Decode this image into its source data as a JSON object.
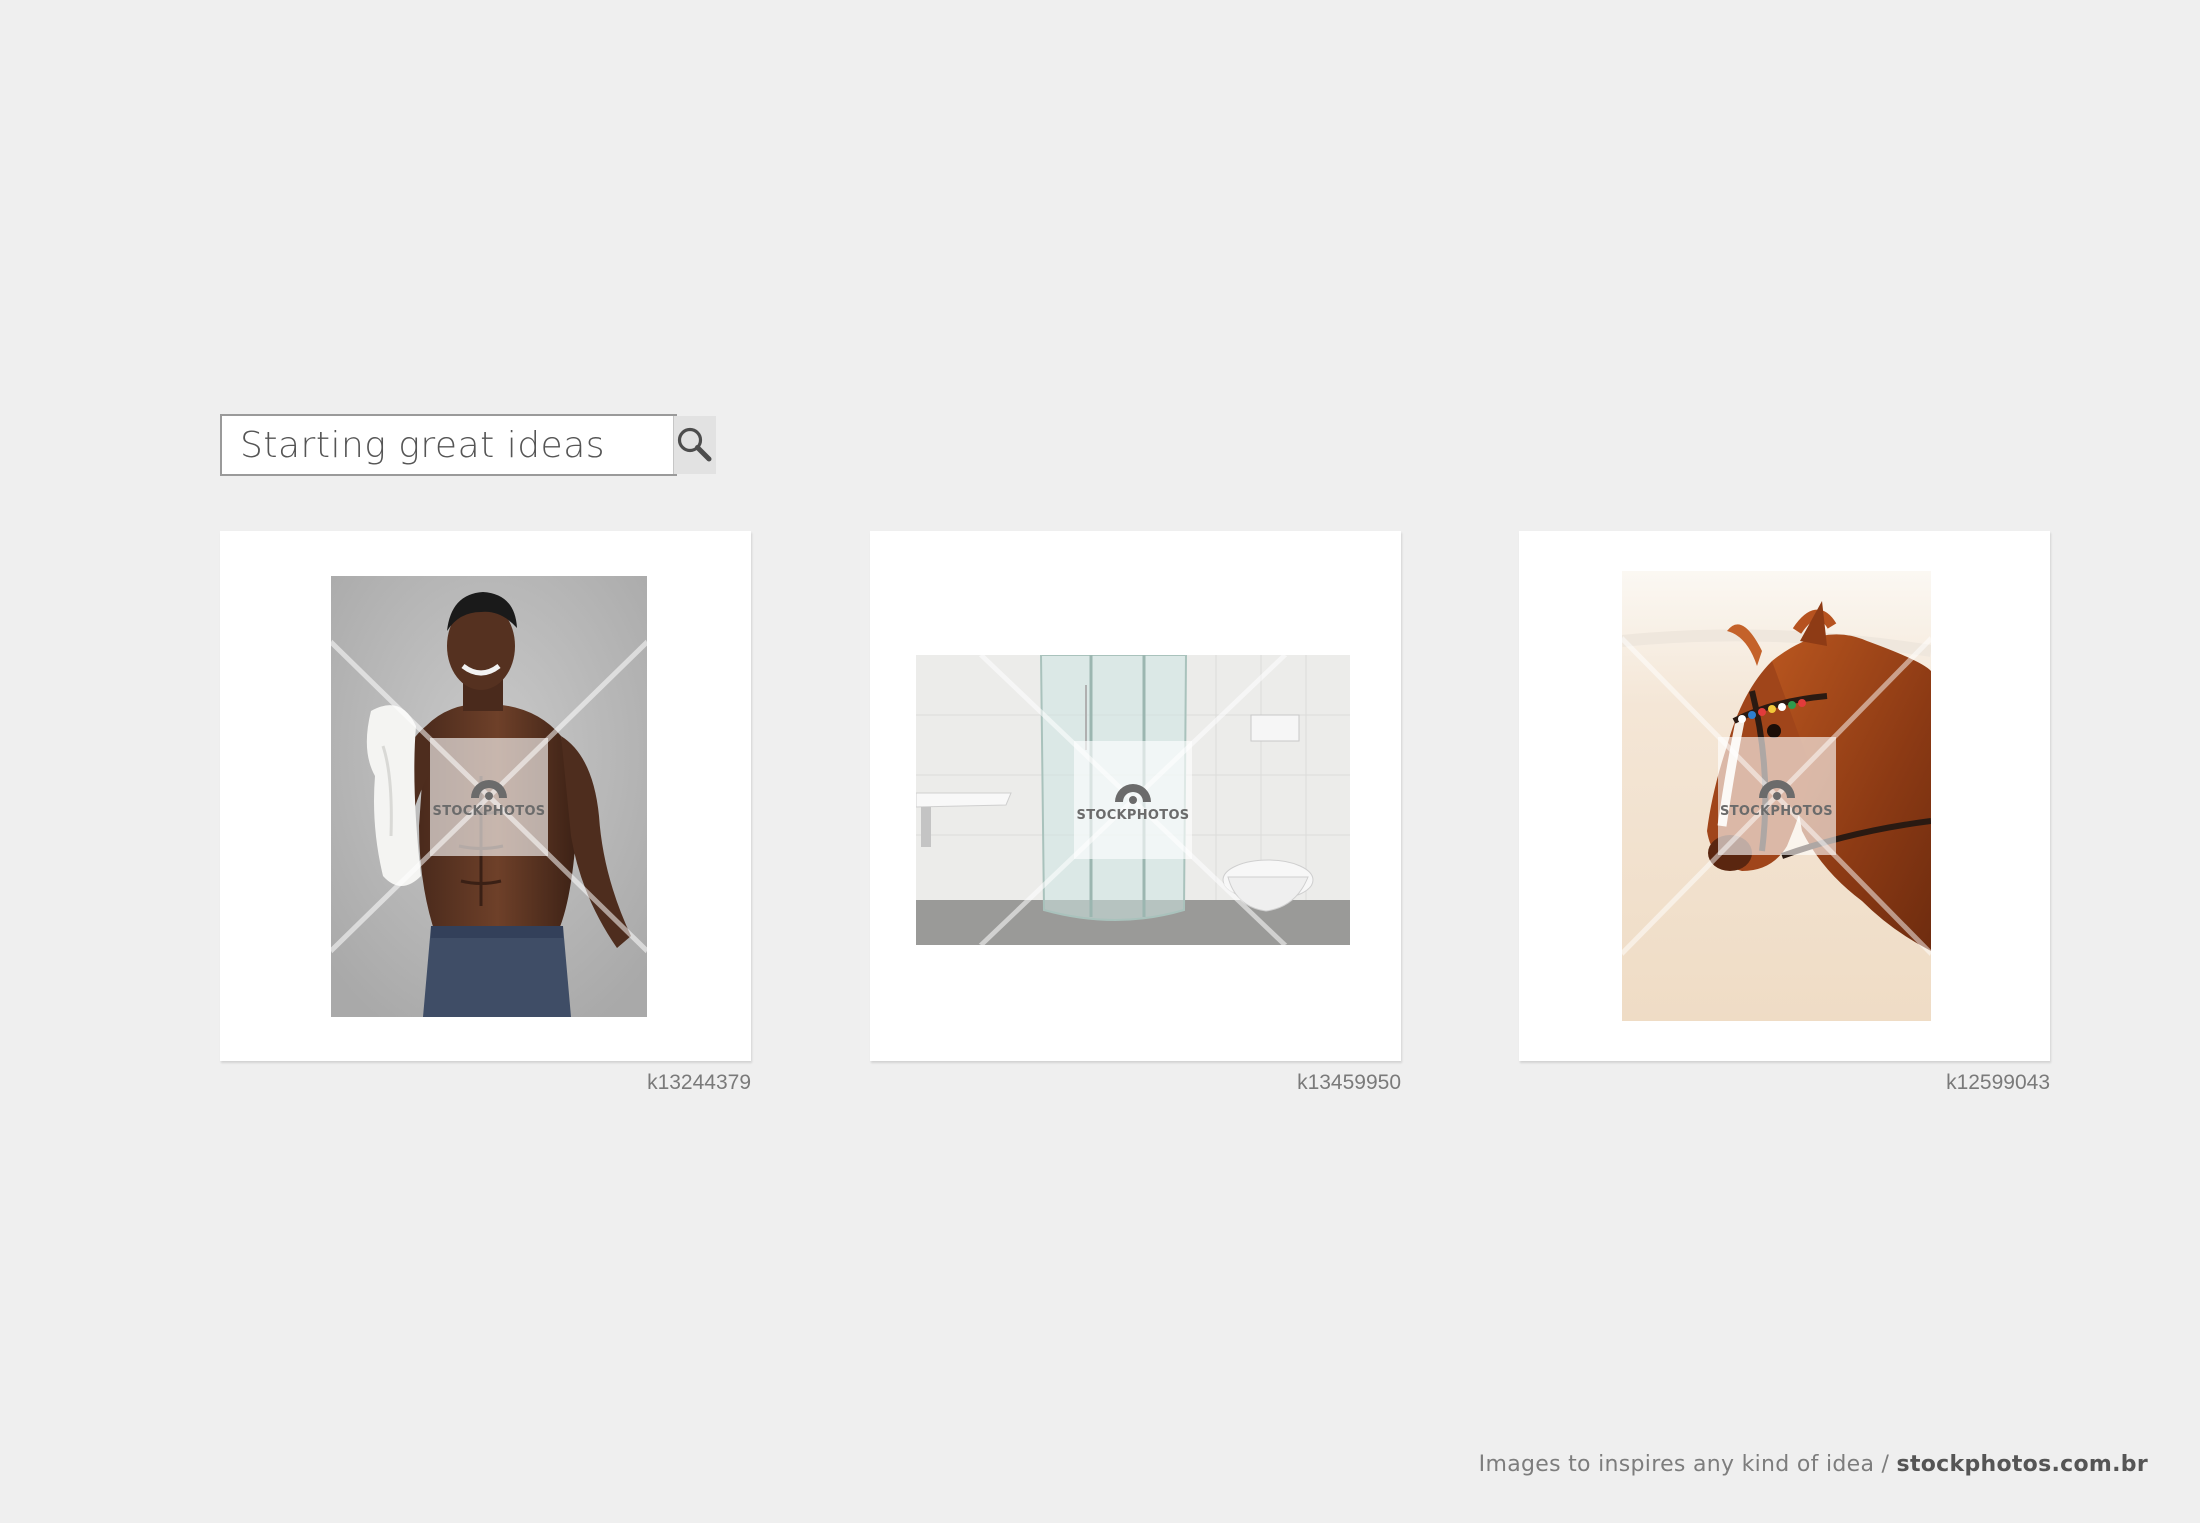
{
  "search": {
    "placeholder": "Starting great ideas",
    "button_icon": "search-icon"
  },
  "watermark": {
    "text": "STOCKPHOTOS",
    "icon": "stockphotos-logo-icon"
  },
  "results": [
    {
      "code": "k13244379",
      "subject": "smiling-man-with-towel"
    },
    {
      "code": "k13459950",
      "subject": "bathroom-with-shower"
    },
    {
      "code": "k12599043",
      "subject": "horse-on-beach"
    }
  ],
  "footer": {
    "tagline": "Images to inspires any kind of idea / ",
    "site": "stockphotos.com.br"
  },
  "colors": {
    "background": "#efefef",
    "card": "#ffffff",
    "text_gray": "#7a7a7a"
  }
}
